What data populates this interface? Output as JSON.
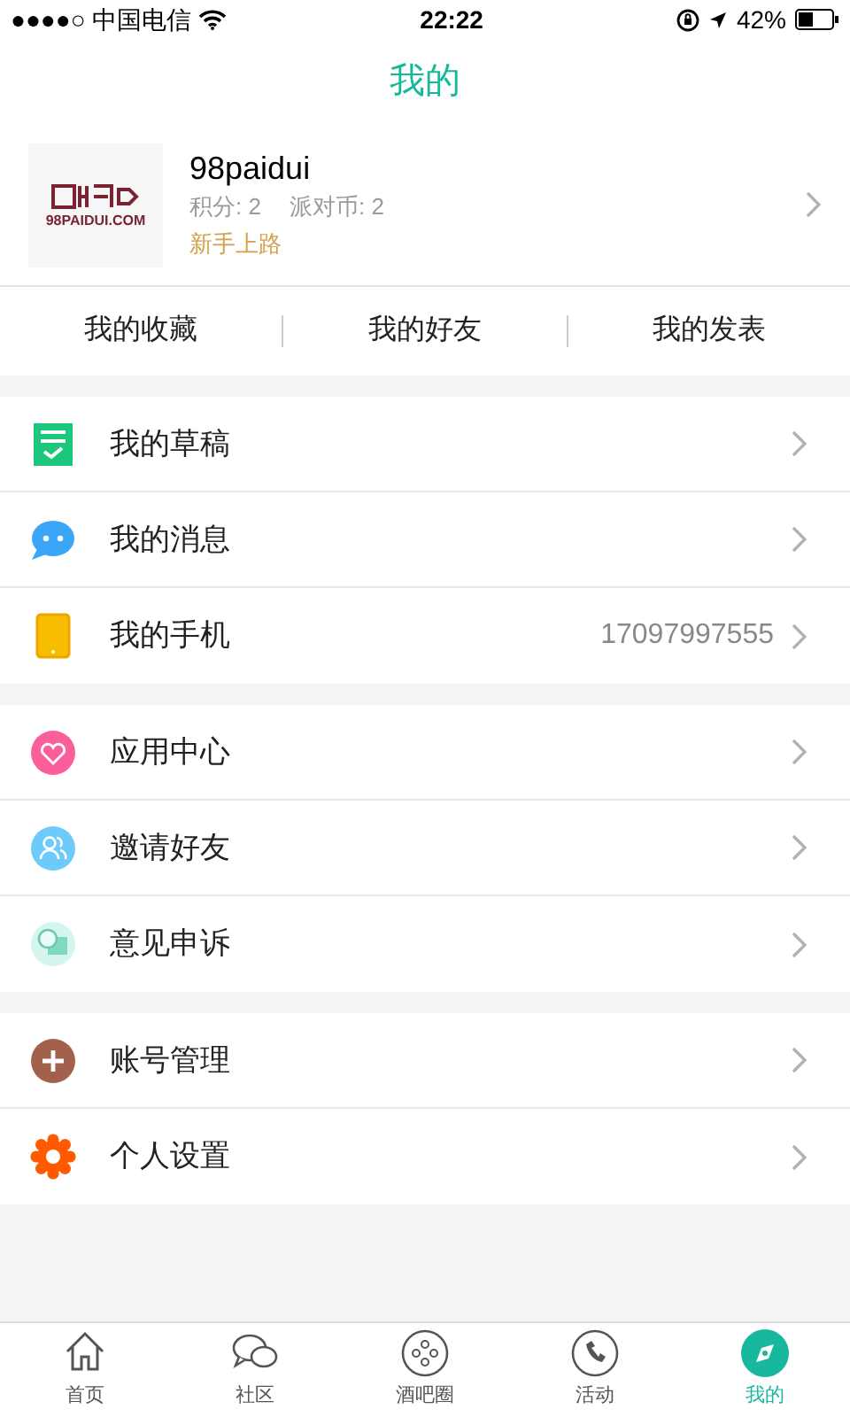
{
  "status_bar": {
    "carrier": "●●●●○ 中国电信",
    "time": "22:22",
    "battery": "42%"
  },
  "header": {
    "title": "我的"
  },
  "profile": {
    "logo_text": "98PAIDUI.COM",
    "name": "98paidui",
    "points": "积分: 2",
    "coins": "派对币: 2",
    "level": "新手上路"
  },
  "quick_links": [
    "我的收藏",
    "我的好友",
    "我的发表"
  ],
  "groups": [
    [
      {
        "kind": "draft",
        "label": "我的草稿"
      },
      {
        "kind": "message",
        "label": "我的消息"
      },
      {
        "kind": "phone",
        "label": "我的手机",
        "value": "17097997555"
      }
    ],
    [
      {
        "kind": "heart",
        "label": "应用中心"
      },
      {
        "kind": "friends",
        "label": "邀请好友"
      },
      {
        "kind": "feedback",
        "label": "意见申诉"
      }
    ],
    [
      {
        "kind": "plus",
        "label": "账号管理"
      },
      {
        "kind": "gear",
        "label": "个人设置"
      }
    ]
  ],
  "tab_bar": [
    {
      "kind": "home",
      "label": "首页",
      "selected": false
    },
    {
      "kind": "chat",
      "label": "社区",
      "selected": false
    },
    {
      "kind": "dots",
      "label": "酒吧圈",
      "selected": false
    },
    {
      "kind": "phone",
      "label": "活动",
      "selected": false
    },
    {
      "kind": "compass",
      "label": "我的",
      "selected": true
    }
  ]
}
